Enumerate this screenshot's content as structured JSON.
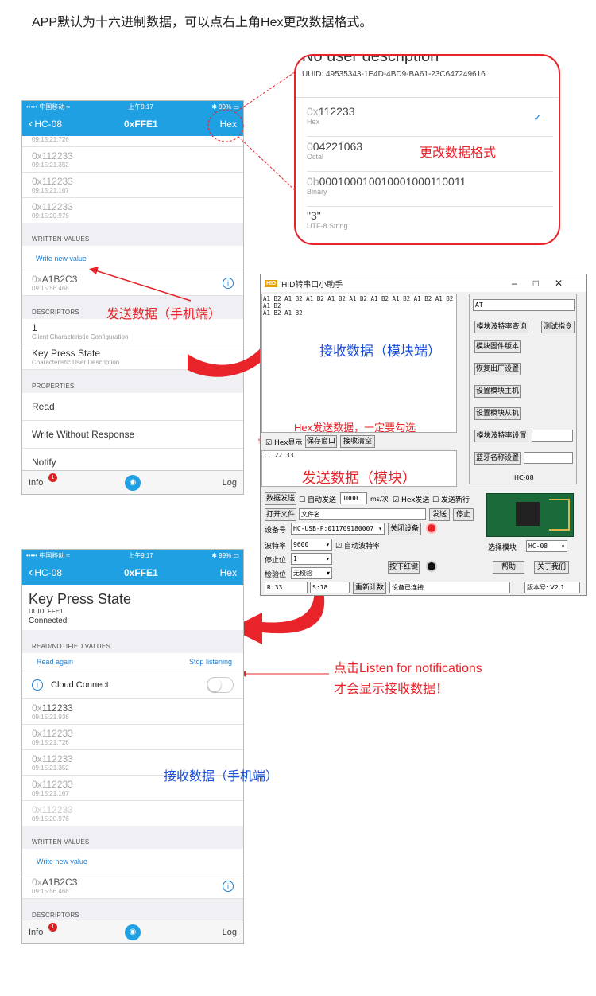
{
  "top_note": "APP默认为十六进制数据，可以点右上角Hex更改数据格式。",
  "phone1": {
    "carrier": "中国移动",
    "time": "上午9:17",
    "battery": "99%",
    "back": "HC-08",
    "title": "0xFFE1",
    "hex_button": "Hex",
    "values": [
      {
        "prefix": "",
        "value": "",
        "ts": "09:15:21.726"
      },
      {
        "prefix": "0x",
        "value": "112233",
        "ts": "09:15:21.352"
      },
      {
        "prefix": "0x",
        "value": "112233",
        "ts": "09:15:21.167"
      },
      {
        "prefix": "0x",
        "value": "112233",
        "ts": "09:15:20.976"
      }
    ],
    "written_header": "WRITTEN VALUES",
    "write_new": "Write new value",
    "written": {
      "prefix": "0x",
      "value": "A1B2C3",
      "ts": "09:15:56.468"
    },
    "descriptors_header": "DESCRIPTORS",
    "desc1_title": "1",
    "desc1_sub": "Client Characteristic Configuration",
    "desc2_title": "Key Press State",
    "desc2_sub": "Characteristic User Description",
    "properties_header": "PROPERTIES",
    "props": [
      "Read",
      "Write Without Response",
      "Notify"
    ],
    "tab_info": "Info",
    "tab_log": "Log",
    "badge": "1"
  },
  "popup": {
    "top_text": "No user description",
    "uuid": "UUID: 49535343-1E4D-4BD9-BA61-23C647249616",
    "options": [
      {
        "prefix": "0x",
        "value": "112233",
        "label": "Hex",
        "checked": "✓"
      },
      {
        "prefix": "0",
        "value": "04221063",
        "label": "Octal"
      },
      {
        "prefix": "0b",
        "value": "000100010010001000110011",
        "label": "Binary"
      },
      {
        "prefix": "",
        "value": "\"3\"",
        "label": "UTF-8 String"
      }
    ],
    "annotation": "更改数据格式"
  },
  "win": {
    "title": "HID转串口小助手",
    "logo": "HID",
    "recv_text": "A1 B2 A1 B2 A1 B2 A1 B2 A1 B2 A1 B2 A1 B2 A1 B2 A1 B2 A1 B2\nA1 B2 A1 B2",
    "recv_annot": "接收数据（模块端）",
    "hex_note": "Hex发送数据，一定要勾选",
    "hex_show": "Hex显示",
    "save_window": "保存窗口",
    "clear_recv": "接收清空",
    "send_text": "11 22 33",
    "send_annot": "发送数据（模块）",
    "at_field": "AT",
    "side_buttons": [
      "模块波特率查询",
      "测试指令",
      "模块固件版本",
      "恢复出厂设置",
      "设置模块主机",
      "设置模块从机",
      "模块波特率设置",
      "蓝牙名称设置"
    ],
    "module_caption": "HC-08",
    "send_data": "数据发送",
    "auto_send": "自动发送",
    "interval": "1000",
    "interval_unit": "ms/次",
    "hex_send": "Hex发送",
    "send_newline": "发送新行",
    "open_file": "打开文件",
    "file_name": "文件名",
    "send": "发送",
    "stop": "停止",
    "device_label": "设备号",
    "device_value": "HC-USB-P:011709180007",
    "close_device": "关闭设备",
    "baud_label": "波特率",
    "baud_value": "9600",
    "auto_baud": "自动波特率",
    "stop_label": "停止位",
    "stop_value": "1",
    "parity_label": "检验位",
    "parity_value": "无校验",
    "press_red": "按下红键",
    "select_module": "选择模块",
    "module_value": "HC-08",
    "help": "帮助",
    "about": "关于我们",
    "r_count": "R:33",
    "s_count": "S:18",
    "reset_count": "重新计数",
    "status": "设备已连接",
    "version": "版本号: V2.1"
  },
  "annot_send_phone": "发送数据（手机端）",
  "phone2": {
    "carrier": "中国移动",
    "time": "上午9:17",
    "battery": "99%",
    "back": "HC-08",
    "title": "0xFFE1",
    "hex_button": "Hex",
    "name": "Key Press State",
    "uuid": "UUID: FFE1",
    "connected": "Connected",
    "read_header": "READ/NOTIFIED VALUES",
    "read_again": "Read again",
    "stop_listening": "Stop listening",
    "cloud": "Cloud Connect",
    "values": [
      {
        "prefix": "0x",
        "value": "112233",
        "ts": "09:15:21.936"
      },
      {
        "prefix": "0x",
        "value": "112233",
        "ts": "09:15:21.726"
      },
      {
        "prefix": "0x",
        "value": "112233",
        "ts": "09:15:21.352"
      },
      {
        "prefix": "0x",
        "value": "112233",
        "ts": "09:15:21.167"
      },
      {
        "prefix": "0x",
        "value": "112233",
        "ts": "09:15:20.976"
      }
    ],
    "written_header": "WRITTEN VALUES",
    "write_new": "Write new value",
    "written": {
      "prefix": "0x",
      "value": "A1B2C3",
      "ts": "09:15:56.468"
    },
    "descriptors_header": "DESCRIPTORS",
    "tab_info": "Info",
    "tab_log": "Log",
    "badge": "1"
  },
  "annot_listen_1": "点击Listen for notifications",
  "annot_listen_2": "才会显示接收数据！",
  "annot_recv_phone": "接收数据（手机端）",
  "colors": {
    "ios_blue": "#1fa0e3",
    "annotation_red": "#e8232a",
    "annotation_blue": "#1a4fd6"
  }
}
